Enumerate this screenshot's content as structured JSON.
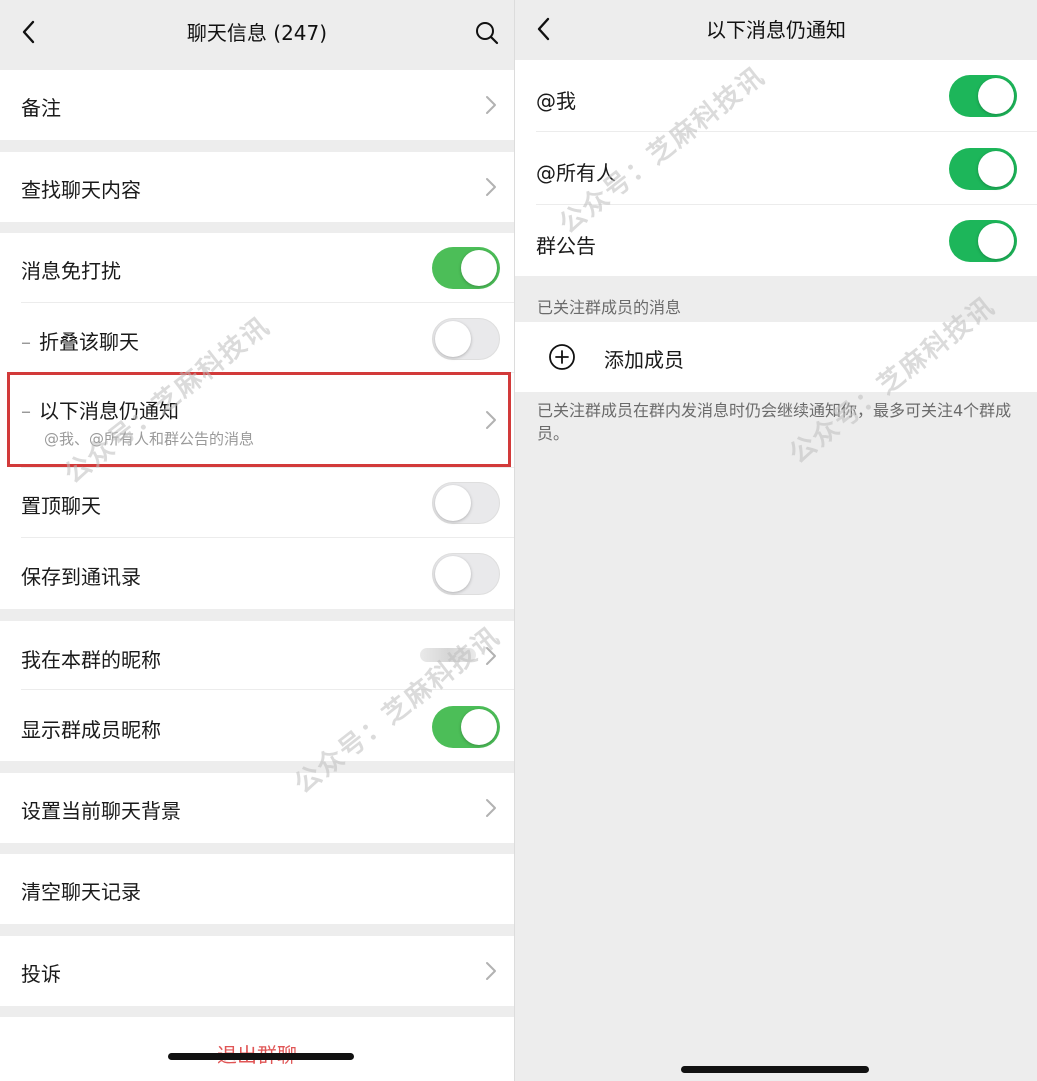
{
  "left": {
    "title": "聊天信息 (247)",
    "items": {
      "remark": "备注",
      "find": "查找聊天内容",
      "mute": "消息免打扰",
      "fold": "折叠该聊天",
      "still_notify": "以下消息仍通知",
      "still_notify_sub": "@我、@所有人和群公告的消息",
      "pin": "置顶聊天",
      "save": "保存到通讯录",
      "nickname": "我在本群的昵称",
      "show_nicknames": "显示群成员昵称",
      "background": "设置当前聊天背景",
      "clear": "清空聊天记录",
      "report": "投诉"
    },
    "exit": "退出群聊",
    "toggles": {
      "mute": true,
      "fold": false,
      "pin": false,
      "save": false,
      "show_nicknames": true
    }
  },
  "right": {
    "title": "以下消息仍通知",
    "items": {
      "at_me": "@我",
      "at_all": "@所有人",
      "announcement": "群公告"
    },
    "toggles": {
      "at_me": true,
      "at_all": true,
      "announcement": true
    },
    "section_title": "已关注群成员的消息",
    "add_member": "添加成员",
    "footnote": "已关注群成员在群内发消息时仍会继续通知你，最多可关注4个群成员。"
  },
  "watermark": "公众号：芝麻科技讯",
  "colors": {
    "toggle_on": "#4cbe58",
    "highlight": "#d23a3a",
    "exit_text": "#e05555"
  }
}
